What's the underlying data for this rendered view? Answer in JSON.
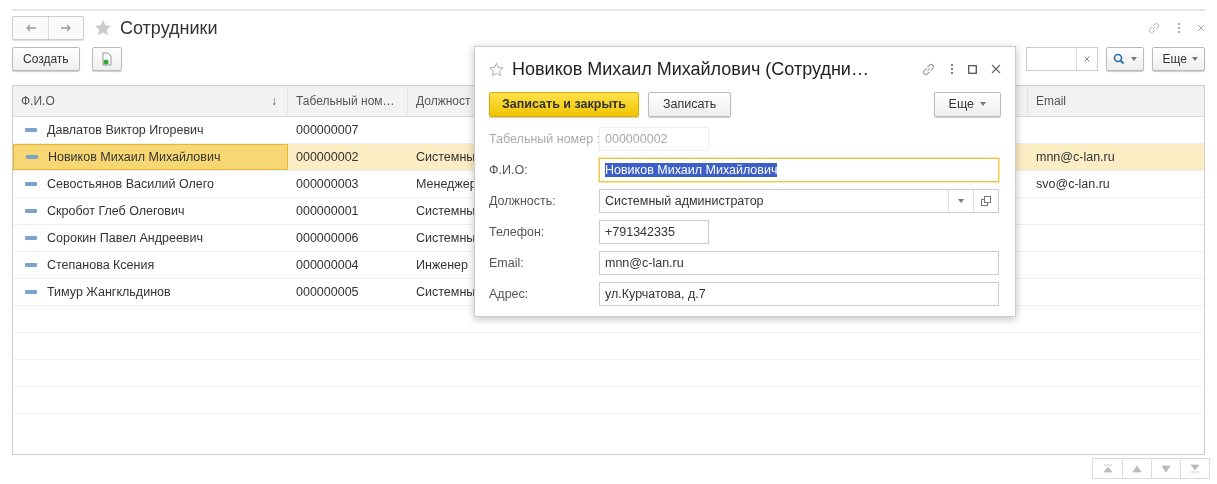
{
  "page_title": "Сотрудники",
  "toolbar": {
    "create_button": "Создать",
    "more_button": "Еще"
  },
  "table": {
    "columns": [
      {
        "label": "Ф.И.О",
        "sort_indicator": "↓"
      },
      {
        "label": "Табельный ном…"
      },
      {
        "label": "Должност"
      },
      {},
      {
        "label": "Email"
      }
    ],
    "rows": [
      {
        "name": "Давлатов Виктор Игоревич",
        "number": "000000007",
        "selected": false
      },
      {
        "name": "Новиков Михаил Михайлович",
        "number": "000000002",
        "position": "Системны",
        "email": "mnn@c-lan.ru",
        "selected": true
      },
      {
        "name": "Севостьянов Василий Олего",
        "number": "000000003",
        "position": "Менеджер",
        "email": "svo@c-lan.ru",
        "selected": false
      },
      {
        "name": "Скробот Глеб Олегович",
        "number": "000000001",
        "position": "Системны",
        "selected": false
      },
      {
        "name": "Сорокин Павел Андреевич",
        "number": "000000006",
        "position": "Системны",
        "selected": false
      },
      {
        "name": "Степанова Ксения",
        "number": "000000004",
        "position": "Инженер",
        "selected": false
      },
      {
        "name": "Тимур Жангкльдинов",
        "number": "000000005",
        "position": "Системны",
        "selected": false
      }
    ]
  },
  "dialog": {
    "title": "Новиков Михаил Михайлович (Сотрудни…",
    "buttons": [
      {
        "label": "Записать и закрыть",
        "kind": "primary"
      },
      {
        "label": "Записать",
        "kind": "default"
      }
    ],
    "more_button": "Еще",
    "fields": [
      {
        "label": "Табельный номер :",
        "value": "000000002",
        "kind": "readonly",
        "wide": false,
        "focused": false
      },
      {
        "label": "Ф.И.О:",
        "value": "Новиков Михаил Михайлович",
        "kind": "text",
        "wide": true,
        "focused": true
      },
      {
        "label": "Должность:",
        "value": "Системный администратор",
        "kind": "select",
        "wide": true,
        "focused": false
      },
      {
        "label": "Телефон:",
        "value": "+791342335",
        "kind": "text",
        "wide": false,
        "focused": false
      },
      {
        "label": "Email:",
        "value": "mnn@c-lan.ru",
        "kind": "text",
        "wide": true,
        "focused": false
      },
      {
        "label": "Адрес:",
        "value": "ул.Курчатова, д.7",
        "kind": "text",
        "wide": true,
        "focused": false
      }
    ]
  }
}
